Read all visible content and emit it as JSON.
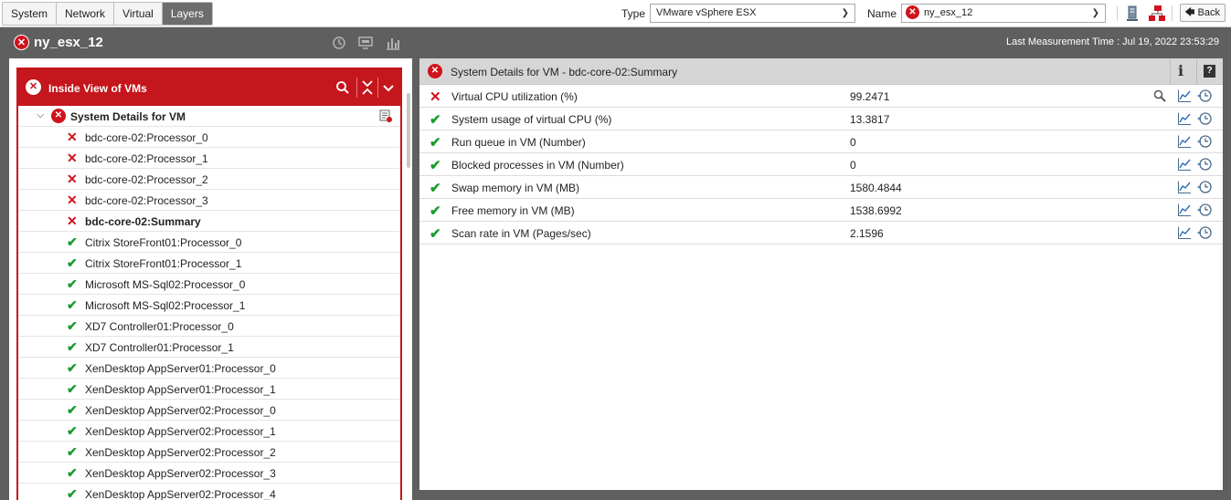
{
  "topbar": {
    "tabs": [
      {
        "label": "System",
        "active": false
      },
      {
        "label": "Network",
        "active": false
      },
      {
        "label": "Virtual",
        "active": false
      },
      {
        "label": "Layers",
        "active": true
      }
    ],
    "type_label": "Type",
    "type_value": "VMware vSphere ESX",
    "name_label": "Name",
    "name_value": "ny_esx_12",
    "back_label": "Back"
  },
  "header": {
    "title": "ny_esx_12",
    "last_measurement": "Last Measurement Time : Jul 19, 2022 23:53:29"
  },
  "left_panel": {
    "title": "Inside View of VMs",
    "group_label": "System Details for VM",
    "items": [
      {
        "label": "bdc-core-02:Processor_0",
        "status": "bad",
        "selected": false
      },
      {
        "label": "bdc-core-02:Processor_1",
        "status": "bad",
        "selected": false
      },
      {
        "label": "bdc-core-02:Processor_2",
        "status": "bad",
        "selected": false
      },
      {
        "label": "bdc-core-02:Processor_3",
        "status": "bad",
        "selected": false
      },
      {
        "label": "bdc-core-02:Summary",
        "status": "bad",
        "selected": true
      },
      {
        "label": "Citrix StoreFront01:Processor_0",
        "status": "good",
        "selected": false
      },
      {
        "label": "Citrix StoreFront01:Processor_1",
        "status": "good",
        "selected": false
      },
      {
        "label": "Microsoft MS-Sql02:Processor_0",
        "status": "good",
        "selected": false
      },
      {
        "label": "Microsoft MS-Sql02:Processor_1",
        "status": "good",
        "selected": false
      },
      {
        "label": "XD7 Controller01:Processor_0",
        "status": "good",
        "selected": false
      },
      {
        "label": "XD7 Controller01:Processor_1",
        "status": "good",
        "selected": false
      },
      {
        "label": "XenDesktop AppServer01:Processor_0",
        "status": "good",
        "selected": false
      },
      {
        "label": "XenDesktop AppServer01:Processor_1",
        "status": "good",
        "selected": false
      },
      {
        "label": "XenDesktop AppServer02:Processor_0",
        "status": "good",
        "selected": false
      },
      {
        "label": "XenDesktop AppServer02:Processor_1",
        "status": "good",
        "selected": false
      },
      {
        "label": "XenDesktop AppServer02:Processor_2",
        "status": "good",
        "selected": false
      },
      {
        "label": "XenDesktop AppServer02:Processor_3",
        "status": "good",
        "selected": false
      },
      {
        "label": "XenDesktop AppServer02:Processor_4",
        "status": "good",
        "selected": false
      }
    ]
  },
  "right_panel": {
    "title": "System Details for VM - bdc-core-02:Summary",
    "metrics": [
      {
        "name": "Virtual CPU utilization (%)",
        "value": "99.2471",
        "status": "bad"
      },
      {
        "name": "System usage of virtual CPU (%)",
        "value": "13.3817",
        "status": "good"
      },
      {
        "name": "Run queue in VM (Number)",
        "value": "0",
        "status": "good"
      },
      {
        "name": "Blocked processes in VM (Number)",
        "value": "0",
        "status": "good"
      },
      {
        "name": "Swap memory in VM (MB)",
        "value": "1580.4844",
        "status": "good"
      },
      {
        "name": "Free memory in VM (MB)",
        "value": "1538.6992",
        "status": "good"
      },
      {
        "name": "Scan rate in VM (Pages/sec)",
        "value": "2.1596",
        "status": "good"
      }
    ]
  },
  "colors": {
    "alert_red": "#c4161c",
    "ok_green": "#1a9b2e",
    "header_gray": "#5f5f5f"
  }
}
